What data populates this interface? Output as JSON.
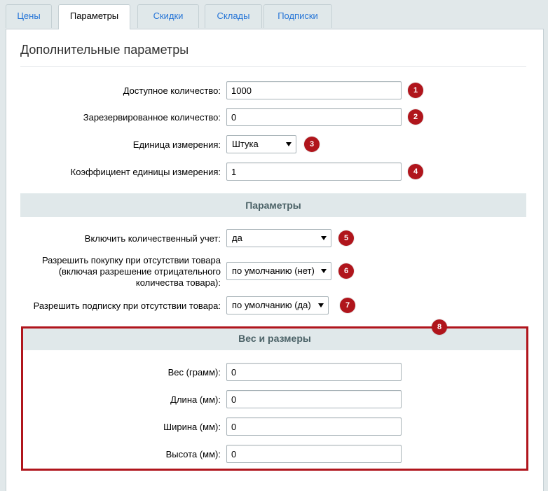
{
  "tabs": [
    {
      "label": "Цены",
      "active": false
    },
    {
      "label": "Параметры",
      "active": true
    },
    {
      "label": "Скидки",
      "active": false
    },
    {
      "label": "Склады",
      "active": false
    },
    {
      "label": "Подписки",
      "active": false
    }
  ],
  "section_title": "Дополнительные параметры",
  "fields": {
    "available_qty": {
      "label": "Доступное количество:",
      "value": "1000",
      "badge": "1"
    },
    "reserved_qty": {
      "label": "Зарезервированное количество:",
      "value": "0",
      "badge": "2"
    },
    "unit": {
      "label": "Единица измерения:",
      "value": "Штука",
      "badge": "3"
    },
    "unit_ratio": {
      "label": "Коэффициент единицы измерения:",
      "value": "1",
      "badge": "4"
    }
  },
  "params_header": "Параметры",
  "params": {
    "quantity_trace": {
      "label": "Включить количественный учет:",
      "value": "да",
      "badge": "5"
    },
    "can_buy_zero": {
      "label": "Разрешить покупку при отсутствии товара (включая разрешение отрицательного количества товара):",
      "value": "по умолчанию (нет)",
      "badge": "6"
    },
    "subscribe": {
      "label": "Разрешить подписку при отсутствии товара:",
      "value": "по умолчанию (да)",
      "badge": "7"
    }
  },
  "dimensions": {
    "header": "Вес и размеры",
    "badge": "8",
    "weight": {
      "label": "Вес (грамм):",
      "value": "0"
    },
    "length": {
      "label": "Длина (мм):",
      "value": "0"
    },
    "width": {
      "label": "Ширина (мм):",
      "value": "0"
    },
    "height": {
      "label": "Высота (мм):",
      "value": "0"
    }
  },
  "colors": {
    "accent_red": "#b0151c",
    "link_blue": "#2675d7",
    "header_bg": "#e0e8ea"
  }
}
